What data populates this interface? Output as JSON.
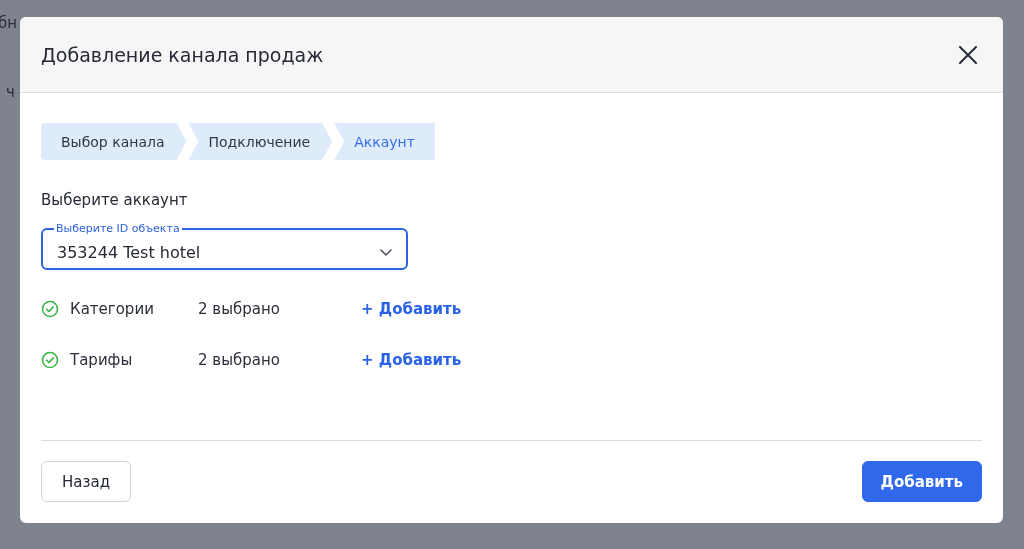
{
  "background": {
    "texts": [
      "бн",
      "ч"
    ]
  },
  "dialog": {
    "title": "Добавление канала продаж",
    "steps": [
      {
        "label": "Выбор канала",
        "selected": false
      },
      {
        "label": "Подключение",
        "selected": false
      },
      {
        "label": "Аккаунт",
        "selected": true
      }
    ],
    "section_title": "Выберите аккаунт",
    "select": {
      "label": "Выберите ID объекта",
      "value": "353244 Test hotel",
      "focused": true
    },
    "items": [
      {
        "label": "Категории",
        "count": "2 выбрано",
        "done": true,
        "action": "+ Добавить"
      },
      {
        "label": "Тарифы",
        "count": "2 выбрано",
        "done": true,
        "action": "+ Добавить"
      }
    ],
    "back_button": "Назад",
    "submit_button": "Добавить"
  }
}
